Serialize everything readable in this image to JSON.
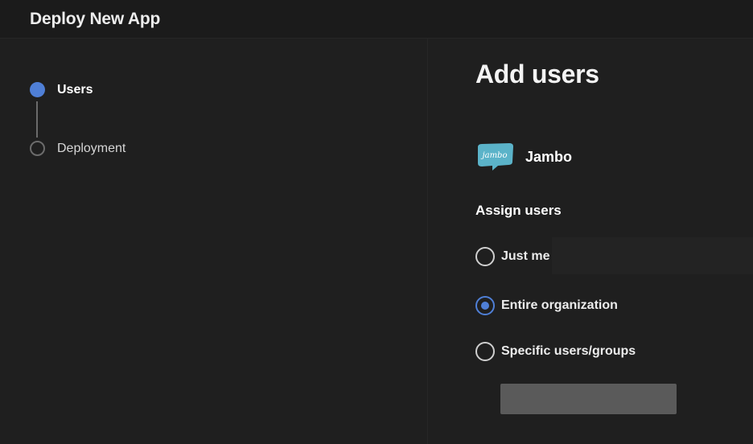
{
  "window": {
    "title": "Deploy New App"
  },
  "stepper": {
    "steps": [
      {
        "label": "Users",
        "state": "active"
      },
      {
        "label": "Deployment",
        "state": "inactive"
      }
    ]
  },
  "main": {
    "heading": "Add users",
    "app": {
      "name": "Jambo",
      "logo_text": "jambo",
      "logo_icon": "chat-bubble-logo-icon",
      "logo_color": "#5bb3c9"
    },
    "assign": {
      "label": "Assign users",
      "options": [
        {
          "label": "Just me",
          "selected": false
        },
        {
          "label": "Entire organization",
          "selected": true
        },
        {
          "label": "Specific users/groups",
          "selected": false
        }
      ]
    },
    "primary_button_label": ""
  },
  "colors": {
    "accent": "#4f7fd6",
    "background": "#1f1f1f",
    "button": "#5a5a5a"
  }
}
